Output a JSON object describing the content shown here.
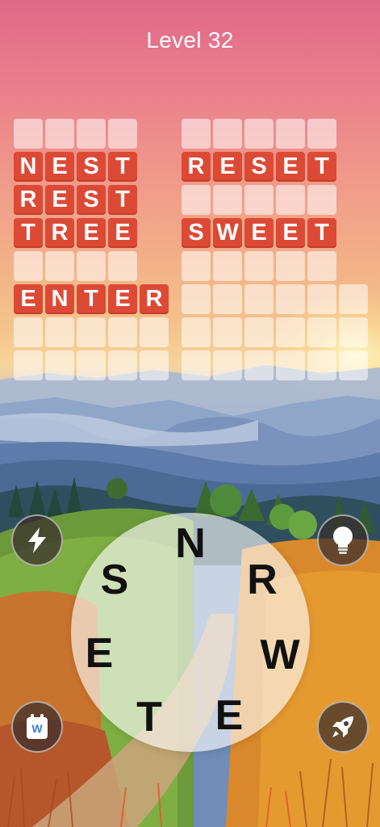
{
  "header": {
    "title": "Level 32"
  },
  "grid": {
    "left": {
      "rows": [
        {
          "letters": [
            "",
            "",
            "",
            ""
          ],
          "solved": false
        },
        {
          "letters": [
            "N",
            "E",
            "S",
            "T"
          ],
          "solved": true
        },
        {
          "letters": [
            "R",
            "E",
            "S",
            "T"
          ],
          "solved": true
        },
        {
          "letters": [
            "T",
            "R",
            "E",
            "E"
          ],
          "solved": true
        },
        {
          "letters": [
            "",
            "",
            "",
            ""
          ],
          "solved": false
        },
        {
          "letters": [
            "E",
            "N",
            "T",
            "E",
            "R"
          ],
          "solved": true
        },
        {
          "letters": [
            "",
            "",
            "",
            "",
            ""
          ],
          "solved": false
        },
        {
          "letters": [
            "",
            "",
            "",
            "",
            ""
          ],
          "solved": false
        }
      ]
    },
    "right": {
      "rows": [
        {
          "letters": [
            "",
            "",
            "",
            "",
            ""
          ],
          "solved": false
        },
        {
          "letters": [
            "R",
            "E",
            "S",
            "E",
            "T"
          ],
          "solved": true
        },
        {
          "letters": [
            "",
            "",
            "",
            "",
            ""
          ],
          "solved": false
        },
        {
          "letters": [
            "S",
            "W",
            "E",
            "E",
            "T"
          ],
          "solved": true
        },
        {
          "letters": [
            "",
            "",
            "",
            "",
            ""
          ],
          "solved": false
        },
        {
          "letters": [
            "",
            "",
            "",
            "",
            "",
            ""
          ],
          "solved": false
        },
        {
          "letters": [
            "",
            "",
            "",
            "",
            "",
            ""
          ],
          "solved": false
        },
        {
          "letters": [
            "",
            "",
            "",
            "",
            "",
            ""
          ],
          "solved": false
        }
      ]
    }
  },
  "wheel": {
    "letters": [
      "N",
      "R",
      "W",
      "E",
      "T",
      "E",
      "S"
    ]
  },
  "buttons": {
    "boost": {
      "icon": "lightning-bolt-icon"
    },
    "hint": {
      "icon": "lightbulb-icon"
    },
    "words": {
      "icon": "word-book-icon",
      "label": "W"
    },
    "rocket": {
      "icon": "rocket-icon"
    }
  },
  "colors": {
    "tile_filled": "#dc4a36",
    "tile_empty": "rgba(255,255,255,0.55)",
    "letter": "#ffffff",
    "wheel_letter": "#111111"
  }
}
